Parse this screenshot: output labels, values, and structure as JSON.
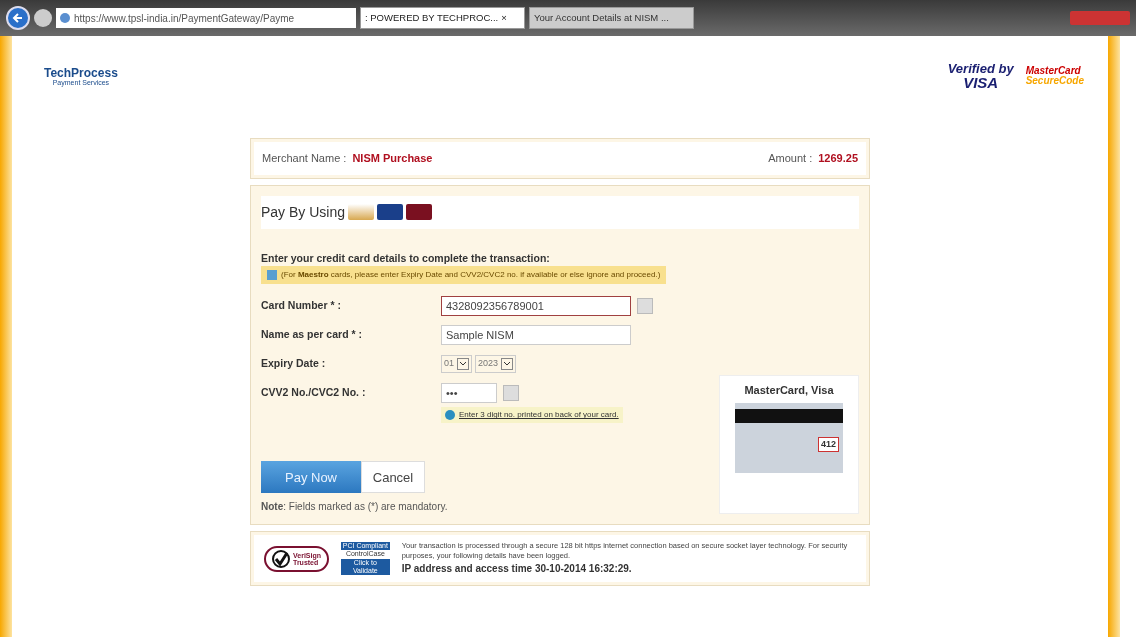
{
  "browser": {
    "address": "https://www.tpsl-india.in/PaymentGateway/Payme",
    "tabs": [
      {
        "title": ": POWERED BY TECHPROC...",
        "selected": true,
        "close": "×"
      },
      {
        "title": "Your Account Details at NISM ...",
        "selected": false
      }
    ]
  },
  "header": {
    "logo_title": "TechProcess",
    "logo_subtitle": "Payment Services",
    "verified_line1": "Verified by",
    "verified_line2": "VISA",
    "mastercard_line1": "MasterCard",
    "mastercard_line2": "SecureCode"
  },
  "merchant": {
    "label": "Merchant Name :",
    "name": "NISM Purchase",
    "amount_label": "Amount :",
    "amount": "1269.25"
  },
  "pay_by_label": "Pay By Using",
  "instructions": "Enter your credit card details to complete the transaction:",
  "notice": "(For **Maestro** cards, please enter Expiry Date and CVV2/CVC2 no. if available or else ignore and proceed.)",
  "fields": [
    {
      "kind": "text",
      "label": "Card Number * :",
      "value": "4328092356789001",
      "focused": true,
      "help": true
    },
    {
      "kind": "text",
      "label": "Name as per card * :",
      "value": "Sample NISM",
      "focused": false,
      "help": false
    },
    {
      "kind": "date",
      "label": "Expiry Date :",
      "month": "01",
      "year": "2023"
    },
    {
      "kind": "password",
      "label": "CVV2 No./CVC2 No. :",
      "value": "•••",
      "focused": false,
      "help": true
    }
  ],
  "cvv_hint": "Enter 3 digit no. printed on back of your card.",
  "card_image": {
    "title": "MasterCard, Visa",
    "cvv": "412"
  },
  "buttons": [
    {
      "label": "Pay Now",
      "kind": "primary"
    },
    {
      "label": "Cancel",
      "kind": "secondary"
    }
  ],
  "note": "**Note**: Fields marked as (*) are mandatory.",
  "footer": {
    "verisign_line1": "VeriSign",
    "verisign_line2": "Trusted",
    "pci_title": "PCI Compliant",
    "pci_brand": "ControlCase",
    "pci_link": "Click to Validate",
    "text": "Your transaction is processed through a secure 128 bit https internet connection based on secure socket layer technology. For security purposes, your following details have been logged.",
    "ip": "IP address and access time 30-10-2014 16:32:29."
  }
}
